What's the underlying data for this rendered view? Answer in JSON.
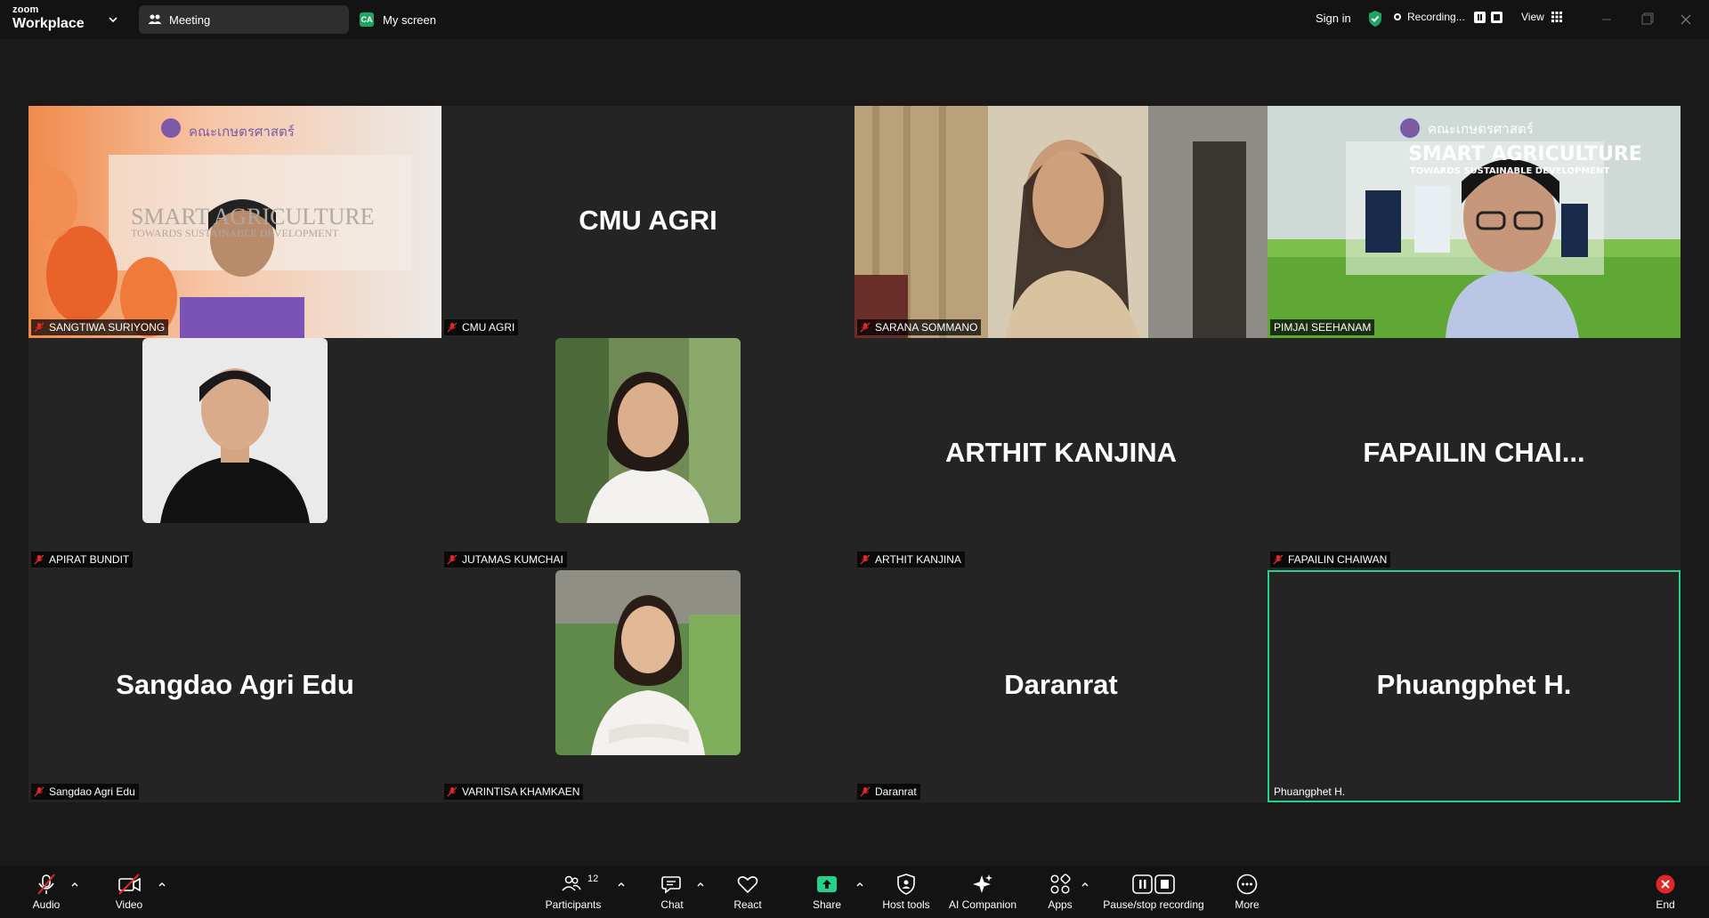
{
  "app": {
    "brand_top": "zoom",
    "brand_bottom": "Workplace"
  },
  "tabs": {
    "meeting": "Meeting",
    "my_screen_badge": "CA",
    "my_screen": "My screen"
  },
  "header": {
    "sign_in": "Sign in",
    "recording": "Recording...",
    "view": "View"
  },
  "colors": {
    "active_speaker": "#23d18b",
    "share_green": "#23d18b",
    "muted_red": "#e02828",
    "end_red": "#e02828"
  },
  "tiles": [
    {
      "name": "SANGTIWA SURIYONG",
      "display": "",
      "muted": true,
      "type": "video",
      "slide_logo": "คณะเกษตรศาสตร์",
      "slide_title": "SMART AGRICULTURE",
      "slide_sub": "TOWARDS SUSTAINABLE DEVELOPMENT"
    },
    {
      "name": "CMU AGRI",
      "display": "CMU AGRI",
      "muted": true,
      "type": "name"
    },
    {
      "name": "SARANA SOMMANO",
      "display": "",
      "muted": true,
      "type": "video"
    },
    {
      "name": "PIMJAI SEEHANAM",
      "display": "",
      "muted": false,
      "type": "video",
      "slide_logo": "คณะเกษตรศาสตร์",
      "slide_title": "SMART AGRICULTURE",
      "slide_sub": "TOWARDS SUSTAINABLE DEVELOPMENT"
    },
    {
      "name": "APIRAT BUNDIT",
      "display": "",
      "muted": true,
      "type": "photo"
    },
    {
      "name": "JUTAMAS KUMCHAI",
      "display": "",
      "muted": true,
      "type": "photo"
    },
    {
      "name": "ARTHIT KANJINA",
      "display": "ARTHIT KANJINA",
      "muted": true,
      "type": "name"
    },
    {
      "name": "FAPAILIN CHAIWAN",
      "display": "FAPAILIN  CHAI...",
      "muted": true,
      "type": "name"
    },
    {
      "name": "Sangdao Agri Edu",
      "display": "Sangdao Agri Edu",
      "muted": true,
      "type": "name"
    },
    {
      "name": "VARINTISA KHAMKAEN",
      "display": "",
      "muted": true,
      "type": "photo"
    },
    {
      "name": "Daranrat",
      "display": "Daranrat",
      "muted": true,
      "type": "name"
    },
    {
      "name": "Phuangphet H.",
      "display": "Phuangphet H.",
      "muted": false,
      "type": "name",
      "active": true
    }
  ],
  "toolbar": {
    "audio": "Audio",
    "video": "Video",
    "participants": "Participants",
    "participants_count": "12",
    "chat": "Chat",
    "react": "React",
    "share": "Share",
    "host_tools": "Host tools",
    "ai_companion": "AI Companion",
    "apps": "Apps",
    "pause_stop": "Pause/stop recording",
    "more": "More",
    "end": "End"
  }
}
